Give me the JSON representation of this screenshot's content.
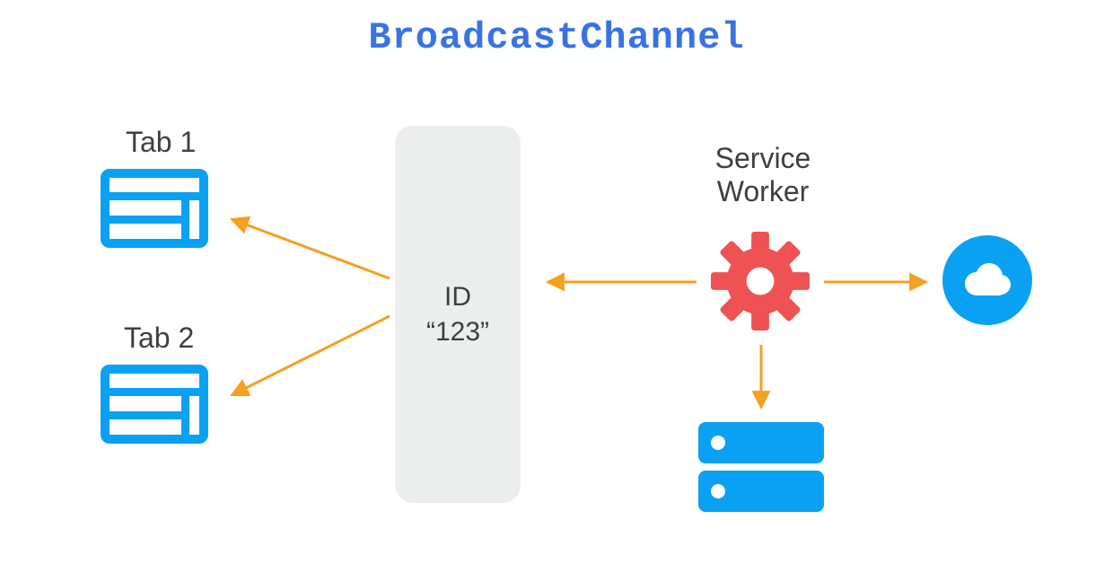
{
  "title": "BroadcastChannel",
  "colors": {
    "title": "#3973e3",
    "accent_blue": "#0aa1f2",
    "accent_red": "#ee5253",
    "arrow": "#f4a020",
    "channel_bg": "#eceded",
    "text": "#3c4043"
  },
  "tabs": [
    {
      "label": "Tab 1"
    },
    {
      "label": "Tab 2"
    }
  ],
  "channel": {
    "line1": "ID",
    "line2": "“123”"
  },
  "service_worker": {
    "line1": "Service",
    "line2": "Worker"
  },
  "icons": {
    "tab": "browser-window-icon",
    "worker": "gear-icon",
    "cloud": "cloud-icon",
    "server": "server-icon"
  },
  "arrows": [
    {
      "from": "channel",
      "to": "tab1"
    },
    {
      "from": "channel",
      "to": "tab2"
    },
    {
      "from": "service_worker",
      "to": "channel"
    },
    {
      "from": "service_worker",
      "to": "cloud"
    },
    {
      "from": "service_worker",
      "to": "server"
    }
  ]
}
